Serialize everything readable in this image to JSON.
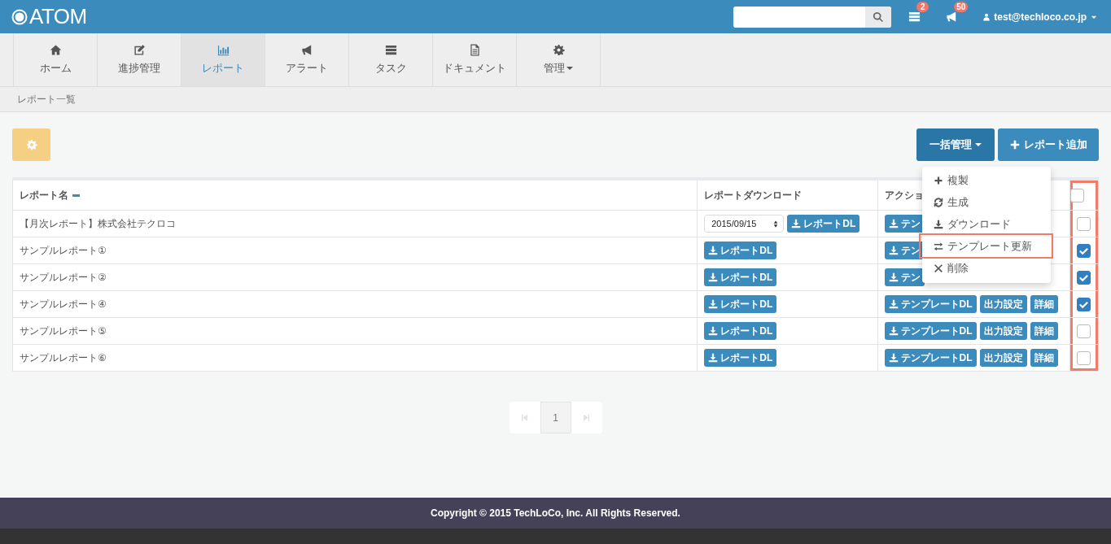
{
  "header": {
    "logo": "ATOM",
    "notifications": [
      {
        "count": "2"
      },
      {
        "count": "50"
      }
    ],
    "user": "test@techloco.co.jp"
  },
  "tabs": [
    {
      "label": "ホーム",
      "selected": false,
      "dropdown": false
    },
    {
      "label": "進捗管理",
      "selected": false,
      "dropdown": false
    },
    {
      "label": "レポート",
      "selected": true,
      "dropdown": false
    },
    {
      "label": "アラート",
      "selected": false,
      "dropdown": false
    },
    {
      "label": "タスク",
      "selected": false,
      "dropdown": false
    },
    {
      "label": "ドキュメント",
      "selected": false,
      "dropdown": false
    },
    {
      "label": "管理",
      "selected": false,
      "dropdown": true
    }
  ],
  "breadcrumb": "レポート一覧",
  "toolbar": {
    "bulk_button": "一括管理",
    "add_button": "レポート追加"
  },
  "bulk_menu": {
    "items": [
      {
        "label": "複製",
        "highlighted": false
      },
      {
        "label": "生成",
        "highlighted": false
      },
      {
        "label": "ダウンロード",
        "highlighted": false
      },
      {
        "label": "テンプレート更新",
        "highlighted": true
      },
      {
        "label": "削除",
        "highlighted": false
      }
    ]
  },
  "table": {
    "columns": [
      "レポート名",
      "レポートダウンロード",
      "アクショ"
    ],
    "header_checked": false,
    "checkbox_column_outlined": true,
    "rows": [
      {
        "name": "【月次レポート】株式会社テクロコ",
        "date": "2015/09/15",
        "download": "レポートDL",
        "actions": [
          "テン"
        ],
        "checked": false
      },
      {
        "name": "サンプルレポート①",
        "download": "レポートDL",
        "actions": [
          "テン"
        ],
        "checked": true
      },
      {
        "name": "サンプルレポート②",
        "download": "レポートDL",
        "actions": [
          "テン"
        ],
        "checked": true
      },
      {
        "name": "サンプルレポート④",
        "download": "レポートDL",
        "actions": [
          "テンプレートDL",
          "出力設定",
          "詳細"
        ],
        "checked": true
      },
      {
        "name": "サンプルレポート⑤",
        "download": "レポートDL",
        "actions": [
          "テンプレートDL",
          "出力設定",
          "詳細"
        ],
        "checked": false
      },
      {
        "name": "サンプルレポート⑥",
        "download": "レポートDL",
        "actions": [
          "テンプレートDL",
          "出力設定",
          "詳細"
        ],
        "checked": false
      }
    ]
  },
  "pagination": {
    "pages": [
      {
        "label": "1",
        "selected": true
      }
    ]
  },
  "footer": "Copyright © 2015 TechLoCo, Inc. All Rights Reserved."
}
